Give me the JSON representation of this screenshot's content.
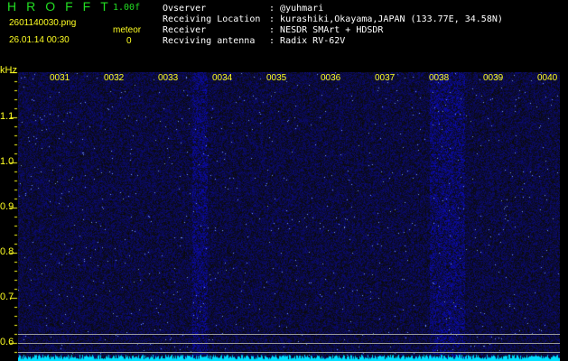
{
  "header": {
    "title": "HROFFT",
    "version": "1.00f",
    "filename": "2601140030.png",
    "datetime": "26.01.14 00:30",
    "meteor_label": "meteor",
    "meteor_count": "0"
  },
  "info": [
    {
      "label": "Ovserver",
      "value": "@yuhmari"
    },
    {
      "label": "Receiving Location",
      "value": "kurashiki,Okayama,JAPAN (133.77E, 34.58N)"
    },
    {
      "label": "Receiver",
      "value": "NESDR SMArt + HDSDR"
    },
    {
      "label": "Recviving antenna",
      "value": "Radix RV-62V"
    }
  ],
  "axis": {
    "unit": "kHz",
    "time_labels": [
      "0031",
      "0032",
      "0033",
      "0034",
      "0035",
      "0036",
      "0037",
      "0038",
      "0039",
      "0040"
    ],
    "freq_labels": [
      "1.1",
      "1.0",
      "0.9",
      "0.8",
      "0.7",
      "0.6"
    ]
  },
  "colors": {
    "background": "#000000",
    "noise": "#2020c0",
    "spectrum": "#00e0ff",
    "label": "#ffff22",
    "title": "#22dd22"
  }
}
